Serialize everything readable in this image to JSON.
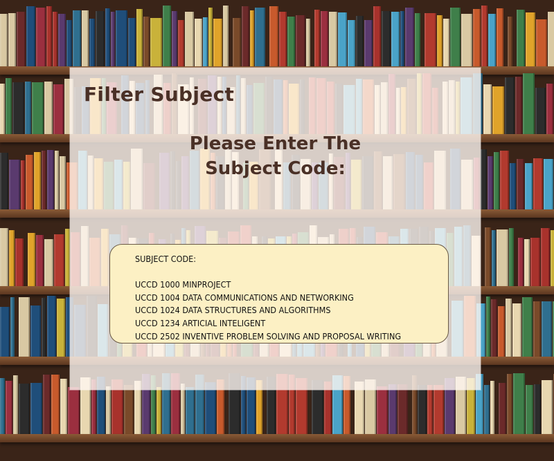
{
  "panel": {
    "title": "Filter Subject",
    "prompt_line1": "Please Enter The",
    "prompt_line2": "Subject Code:"
  },
  "subject_list": {
    "heading": "SUBJECT CODE:",
    "items": [
      "UCCD 1000 MINPROJECT",
      "UCCD 1004 DATA COMMUNICATIONS AND NETWORKING",
      "UCCD 1024 DATA STRUCTURES AND ALGORITHMS",
      "UCCD 1234 ARTICIAL INTELIGENT",
      "UCCD 2502 INVENTIVE PROBLEM SOLVING AND PROPOSAL WRITING"
    ]
  },
  "colors": {
    "title_text": "#4a3026",
    "panel_bg": "#fff8f2",
    "code_box_bg": "#fcf0c4"
  }
}
